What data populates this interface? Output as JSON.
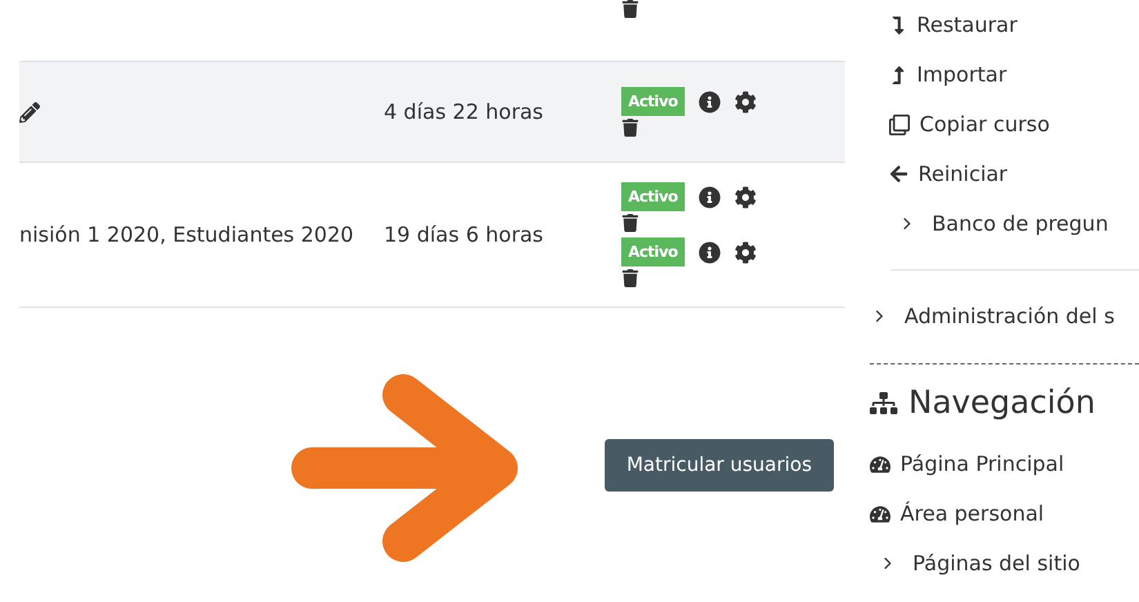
{
  "enrolment_table": {
    "rows": [
      {
        "highlighted": false,
        "editable": false,
        "methods": [
          {
            "kind": "trash"
          }
        ]
      },
      {
        "highlighted": true,
        "editable": true,
        "duration": "4 días 22 horas",
        "methods": [
          {
            "kind": "status",
            "status": "Activo"
          }
        ]
      },
      {
        "highlighted": false,
        "editable": false,
        "groups": "nisión 1 2020, Estudiantes 2020",
        "duration": "19 días 6 horas",
        "methods": [
          {
            "kind": "status",
            "status": "Activo"
          },
          {
            "kind": "status",
            "status": "Activo"
          }
        ]
      }
    ]
  },
  "enrol_button": "Matricular usuarios",
  "course_admin": {
    "items": [
      {
        "kind": "restore",
        "label": "Restaurar"
      },
      {
        "kind": "import",
        "label": "Importar"
      },
      {
        "kind": "copy",
        "label": "Copiar curso"
      },
      {
        "kind": "reset",
        "label": "Reiniciar"
      },
      {
        "kind": "branch",
        "label": "Banco de pregun"
      }
    ]
  },
  "site_admin": {
    "label": "Administración del s"
  },
  "navigation": {
    "title": "Navegación",
    "items": [
      {
        "kind": "dashboard",
        "label": "Página Principal"
      },
      {
        "kind": "dashboard",
        "label": "Área personal"
      },
      {
        "kind": "branch",
        "label": "Páginas del sitio"
      }
    ]
  }
}
